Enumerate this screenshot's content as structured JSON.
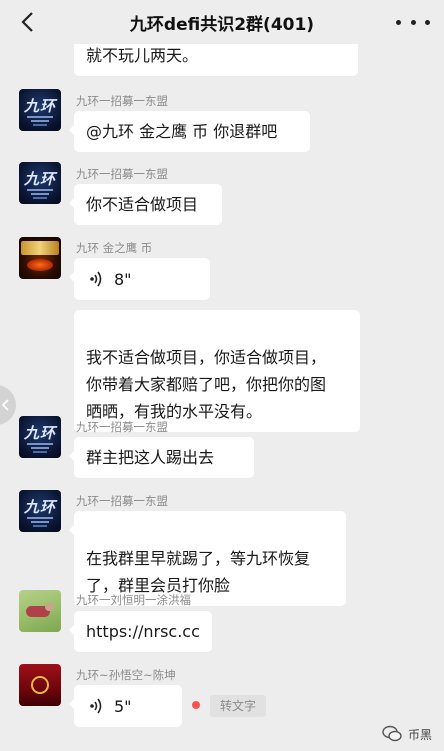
{
  "header": {
    "title": "九环defi共识2群(401)"
  },
  "messages": [
    {
      "text": "就不玩儿两天。"
    },
    {
      "nick": "九环一招募一东盟",
      "text": "@九环 金之鹰 币  你退群吧"
    },
    {
      "nick": "九环一招募一东盟",
      "text": "你不适合做项目"
    },
    {
      "nick": "九环 金之鹰 币",
      "voice_duration": "8\"",
      "text": "我不适合做项目，你适合做项目，\n你带着大家都赔了吧，你把你的图\n晒晒，有我的水平没有。"
    },
    {
      "nick": "九环一招募一东盟",
      "text": "群主把这人踢出去"
    },
    {
      "nick": "九环一招募一东盟",
      "text": "在我群里早就踢了，等九环恢复\n了，群里会员打你脸"
    },
    {
      "nick": "九环一刘恒明一涂洪福",
      "text": "https://nrsc.cc"
    },
    {
      "nick": "九环~孙悟空~陈坤",
      "voice_duration": "5\"",
      "to_text_label": "转文字"
    }
  ],
  "watermark": {
    "text": "币黑"
  },
  "avatar_logo_text": "九环",
  "colors": {
    "background": "#ededed",
    "bubble": "#ffffff",
    "nickname": "#8b8b8b",
    "unread_dot": "#fa5151"
  },
  "icons": {
    "back": "chevron-left-icon",
    "more": "more-dots-icon",
    "voice": "voice-wave-icon",
    "side_handle": "chevron-left-icon",
    "watermark_logo": "wechat-official-account-icon"
  }
}
